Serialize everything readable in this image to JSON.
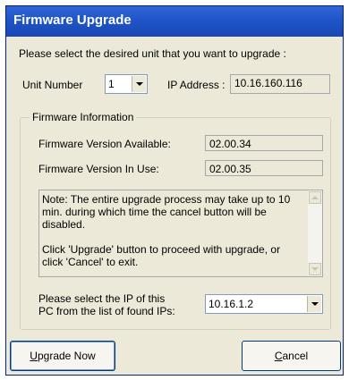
{
  "window": {
    "title": "Firmware Upgrade"
  },
  "prompt": "Please select the desired unit that you want to upgrade :",
  "unit": {
    "label": "Unit Number",
    "value": "1"
  },
  "ip_address": {
    "label": "IP Address :",
    "value": "10.16.160.116"
  },
  "firmware_info": {
    "title": "Firmware Information",
    "available_label": "Firmware Version Available:",
    "available_value": "02.00.34",
    "in_use_label": "Firmware Version In Use:",
    "in_use_value": "02.00.35",
    "note": "Note: The entire upgrade process may take up to 10 min. during which time the cancel button will be disabled.\n\nClick 'Upgrade' button to proceed with upgrade, or click 'Cancel' to exit.",
    "ip_select_label_line1": "Please select the IP of this",
    "ip_select_label_line2": "PC from the list of found IPs:",
    "ip_select_value": "10.16.1.2"
  },
  "buttons": {
    "upgrade_mnemonic": "U",
    "upgrade_rest": "pgrade Now",
    "cancel_mnemonic": "C",
    "cancel_rest": "ancel"
  },
  "icons": {
    "dropdown": "chevron-down-icon",
    "scroll_up": "scroll-up-arrow-icon",
    "scroll_down": "scroll-down-arrow-icon"
  },
  "colors": {
    "titlebar": "#1f55c8",
    "dialog_bg": "#ece9d8",
    "button_border": "#003c74"
  }
}
